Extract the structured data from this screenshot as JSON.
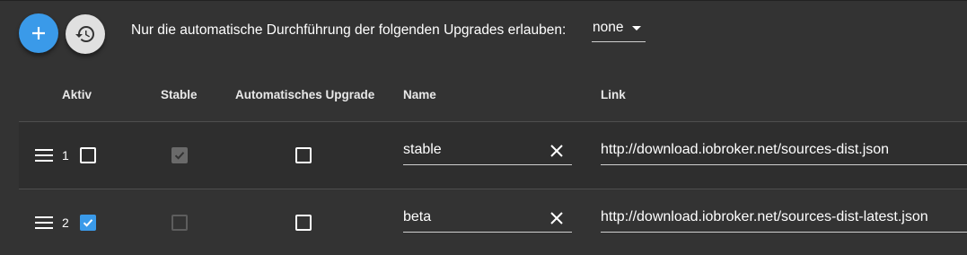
{
  "toolbar": {
    "add_icon": "plus-icon",
    "restore_icon": "restore-icon",
    "upgrade_label": "Nur die automatische Durchführung der folgenden Upgrades erlauben:",
    "upgrade_select_value": "none"
  },
  "table": {
    "headers": {
      "active": "Aktiv",
      "stable": "Stable",
      "auto_upgrade": "Automatisches Upgrade",
      "name": "Name",
      "link": "Link"
    },
    "rows": [
      {
        "index": "1",
        "active": false,
        "stable": true,
        "stable_disabled": true,
        "auto_upgrade": false,
        "name": "stable",
        "link": "http://download.iobroker.net/sources-dist.json"
      },
      {
        "index": "2",
        "active": true,
        "stable": false,
        "stable_disabled": true,
        "auto_upgrade": false,
        "name": "beta",
        "link": "http://download.iobroker.net/sources-dist-latest.json"
      }
    ]
  },
  "colors": {
    "background": "#333333",
    "accent": "#3a9ae9",
    "secondary_fab": "#e0e0e0"
  }
}
